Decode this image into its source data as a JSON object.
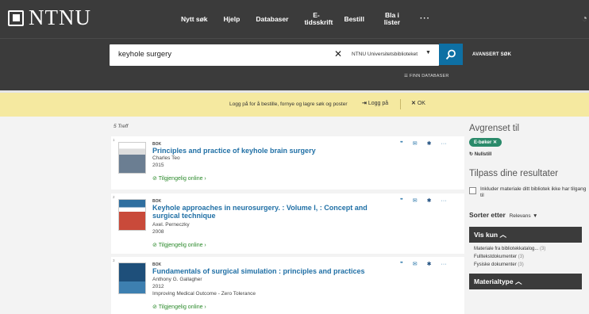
{
  "header": {
    "logo_text": "NTNU",
    "nav": [
      "Nytt søk",
      "Hjelp",
      "Databaser",
      "E-\ntidsskrift",
      "Bestill",
      "Bla i\nlister",
      "···"
    ]
  },
  "search": {
    "query": "keyhole surgery",
    "scope": "NTNU Universitetsbiblioteket",
    "advanced_label": "AVANSERT SØK",
    "find_db_label": "FINN DATABASER"
  },
  "banner": {
    "text": "Logg på for å bestille, fornye og lagre søk og poster",
    "login_label": "Logg på",
    "ok_label": "OK"
  },
  "results": {
    "count_label": "5 Treff",
    "items": [
      {
        "num": "1",
        "type": "BOK",
        "title": "Principles and practice of keyhole brain surgery",
        "author": "Charles Teo",
        "year": "2015",
        "extra": "",
        "availability": "Tilgjengelig online"
      },
      {
        "num": "2",
        "type": "BOK",
        "title": "Keyhole approaches in neurosurgery. : Volume I, : Concept and surgical technique",
        "author": "Axel. Perneczky",
        "year": "2008",
        "extra": "",
        "availability": "Tilgjengelig online"
      },
      {
        "num": "3",
        "type": "BOK",
        "title": "Fundamentals of surgical simulation : principles and practices",
        "author": "Anthony G. Gallagher",
        "year": "2012",
        "extra": "Improving Medical Outcome - Zero Tolerance",
        "availability": "Tilgjengelig online"
      }
    ]
  },
  "sidebar": {
    "refined_title": "Avgrenset til",
    "chip_label": "E-bøker",
    "reset_label": "Nullstill",
    "tailor_title": "Tilpass dine resultater",
    "include_label": "Inkluder materiale ditt bibliotek ikke har tilgang til",
    "sort_label": "Sorter etter",
    "sort_value": "Relevans",
    "show_only_title": "Vis kun",
    "show_only_items": [
      {
        "label": "Materiale fra bibliotekkatalog...",
        "count": "(3)"
      },
      {
        "label": "Fulltekstdokumenter",
        "count": "(3)"
      },
      {
        "label": "Fysiske dokumenter",
        "count": "(3)"
      }
    ],
    "material_type_title": "Materialtype"
  },
  "colors": {
    "header_bg": "#3b3b3b",
    "accent_blue": "#0e70a4",
    "banner_bg": "#f5e9a0",
    "online_green": "#2b8a2b",
    "chip_green": "#2a8a6a"
  }
}
